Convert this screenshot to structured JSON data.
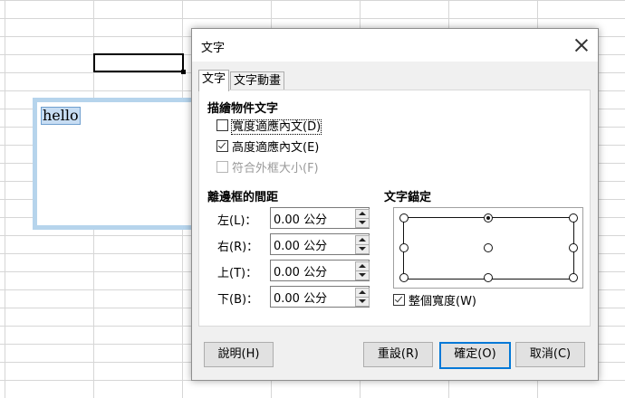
{
  "sheet": {
    "textbox_text": "hello"
  },
  "dialog": {
    "title": "文字",
    "tabs": [
      {
        "label": "文字",
        "active": true
      },
      {
        "label": "文字動畫",
        "active": false
      }
    ],
    "draw_section": {
      "title": "描繪物件文字",
      "options": [
        {
          "label": "寬度適應內文(D)",
          "checked": false,
          "disabled": false
        },
        {
          "label": "高度適應內文(E)",
          "checked": true,
          "disabled": false
        },
        {
          "label": "符合外框大小(F)",
          "checked": false,
          "disabled": true
        }
      ]
    },
    "spacing_section": {
      "title": "離邊框的間距",
      "fields": [
        {
          "label": "左(L)：",
          "value": "0.00 公分"
        },
        {
          "label": "右(R)：",
          "value": "0.00 公分"
        },
        {
          "label": "上(T)：",
          "value": "0.00 公分"
        },
        {
          "label": "下(B)：",
          "value": "0.00 公分"
        }
      ]
    },
    "anchor_section": {
      "title": "文字錨定",
      "selected_anchor": "top-center",
      "full_width": {
        "label": "整個寬度(W)",
        "checked": true
      }
    },
    "buttons": {
      "help": "說明(H)",
      "reset": "重設(R)",
      "ok": "確定(O)",
      "cancel": "取消(C)"
    },
    "icons": {
      "close": "close-icon",
      "spin_up": "chevron-up-icon",
      "spin_down": "chevron-down-icon"
    },
    "colors": {
      "default_button_border": "#0078d7",
      "selection_frame": "#b6d4ec"
    }
  }
}
